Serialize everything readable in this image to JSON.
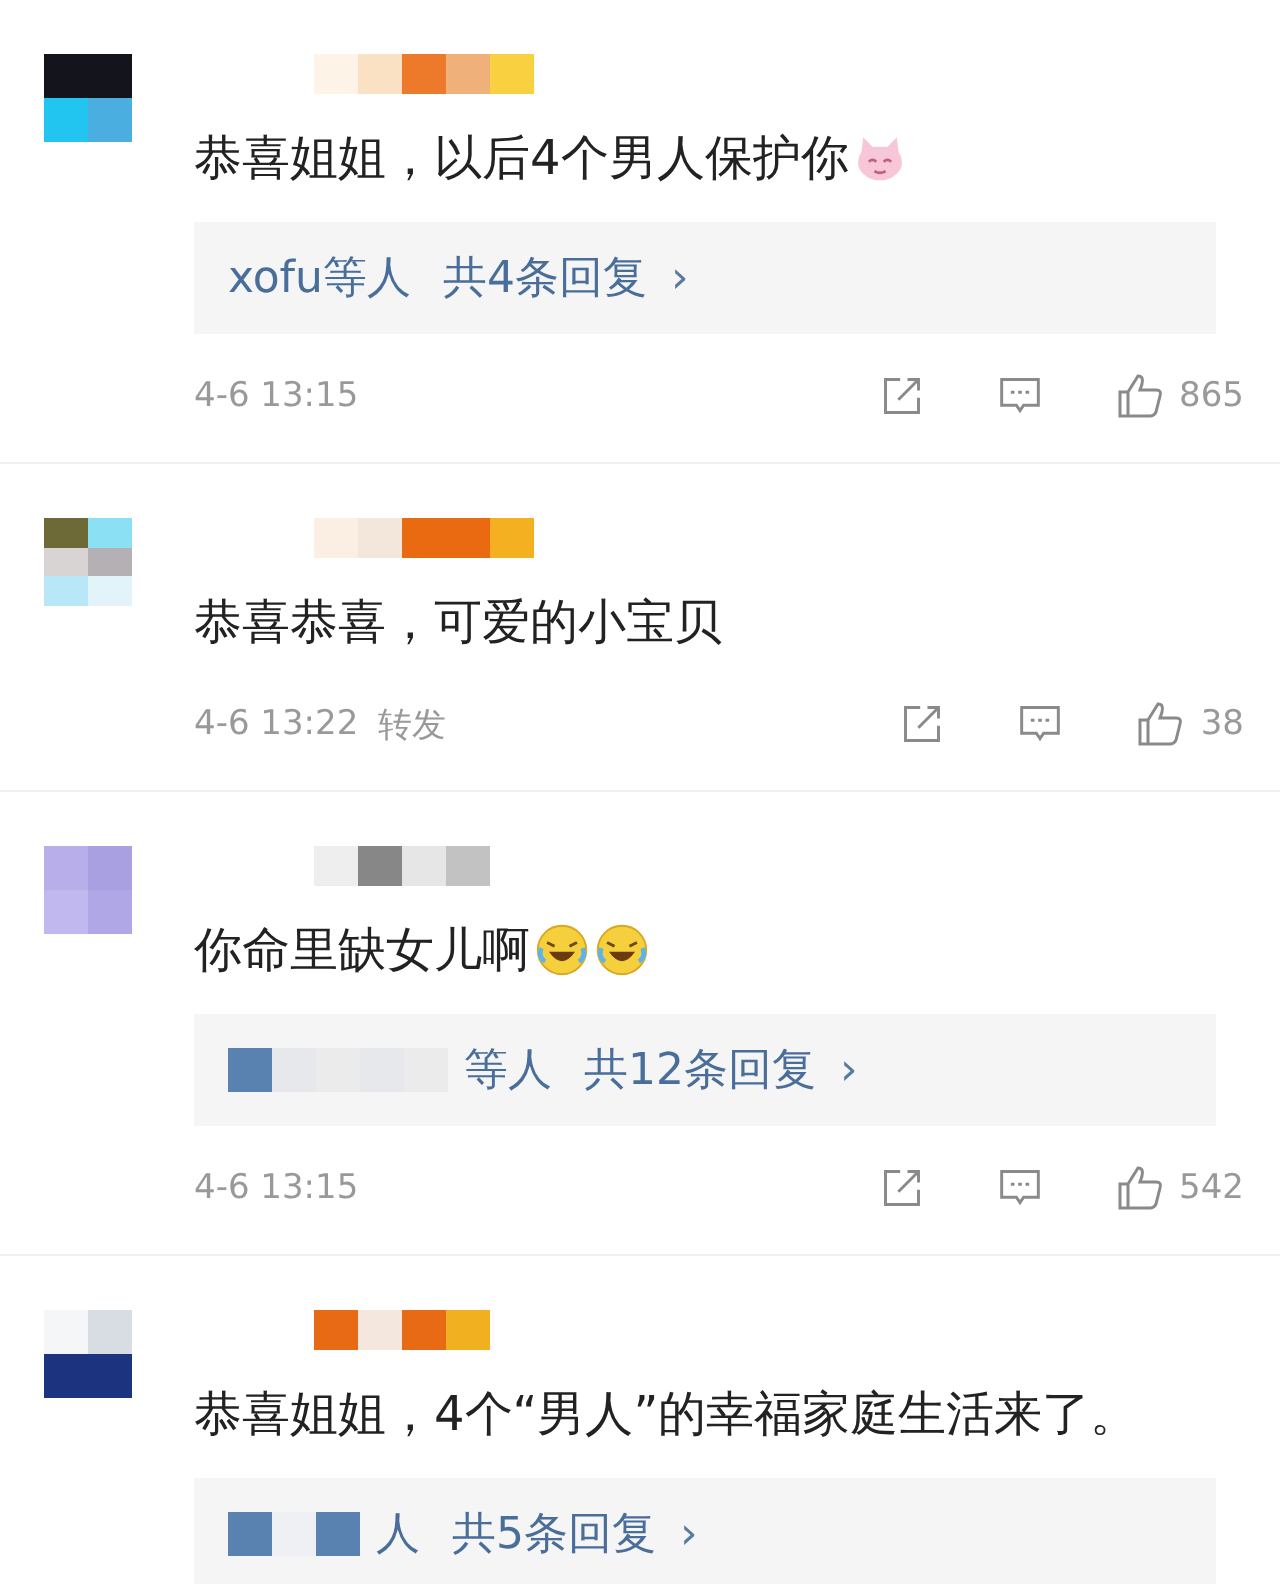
{
  "comments": [
    {
      "avatar_tiles": [
        {
          "color": "#14141c"
        },
        {
          "color": "#14141c"
        },
        {
          "color": "#22c4f0"
        },
        {
          "color": "#4aaee0"
        }
      ],
      "name_tiles": [
        {
          "color": "#fdf3e6"
        },
        {
          "color": "#fbe1c4"
        },
        {
          "color": "#ec7a2a"
        },
        {
          "color": "#efb07a"
        },
        {
          "color": "#f8d040"
        }
      ],
      "text": "恭喜姐姐，以后4个男人保护你",
      "emojis": [
        {
          "kind": "pig"
        }
      ],
      "replies": {
        "names": "xofu等人",
        "count": "共4条回复",
        "arrow": "›"
      },
      "meta": {
        "time": "4-6 13:15",
        "likes": "865"
      }
    },
    {
      "avatar_tiles": [
        {
          "color": "#6e6a38"
        },
        {
          "color": "#8ce0f4"
        },
        {
          "color": "#d8d4d4"
        },
        {
          "color": "#b4b0b4"
        },
        {
          "color": "#b8e8f8"
        },
        {
          "color": "#e2f4fa"
        }
      ],
      "name_tiles": [
        {
          "color": "#fbeee2"
        },
        {
          "color": "#f3e6da"
        },
        {
          "color": "#ea6a12"
        },
        {
          "color": "#ea6a12"
        },
        {
          "color": "#f4b020"
        }
      ],
      "text": "恭喜恭喜，可爱的小宝贝",
      "meta": {
        "time": "4-6 13:22",
        "forward": "转发",
        "likes": "38"
      }
    },
    {
      "avatar_tiles": [
        {
          "color": "#b8aeea"
        },
        {
          "color": "#a8a0e0"
        },
        {
          "color": "#c0b8ee"
        },
        {
          "color": "#b0a8e6"
        }
      ],
      "name_tiles": [
        {
          "color": "#eeeeee"
        },
        {
          "color": "#878787"
        },
        {
          "color": "#e6e6e6"
        },
        {
          "color": "#c2c2c2"
        }
      ],
      "text": "你命里缺女儿啊",
      "emojis": [
        {
          "kind": "laughing"
        },
        {
          "kind": "laughing"
        }
      ],
      "replies": {
        "names": "等人",
        "count": "共12条回复",
        "arrow": "›",
        "name_tiles": [
          {
            "color": "#5a82b0"
          },
          {
            "color": "#e6e8ec"
          },
          {
            "color": "#ebebeb"
          },
          {
            "color": "#e6e8ec"
          },
          {
            "color": "#ebebeb"
          }
        ]
      },
      "meta": {
        "time": "4-6 13:15",
        "likes": "542"
      }
    },
    {
      "avatar_tiles": [
        {
          "color": "#f4f6f8"
        },
        {
          "color": "#d8dde4"
        },
        {
          "color": "#1c3480"
        },
        {
          "color": "#1c3480"
        }
      ],
      "name_tiles": [
        {
          "color": "#e86a14"
        },
        {
          "color": "#f4e8de"
        },
        {
          "color": "#e86a14"
        },
        {
          "color": "#f0b020"
        }
      ],
      "text": "恭喜姐姐，4个“男人”的幸福家庭生活来了。",
      "replies": {
        "names": "人",
        "count": "共5条回复",
        "arrow": "›",
        "name_tiles": [
          {
            "color": "#5a82b0"
          },
          {
            "color": "#eef0f4"
          },
          {
            "color": "#5a82b0"
          }
        ]
      }
    }
  ]
}
